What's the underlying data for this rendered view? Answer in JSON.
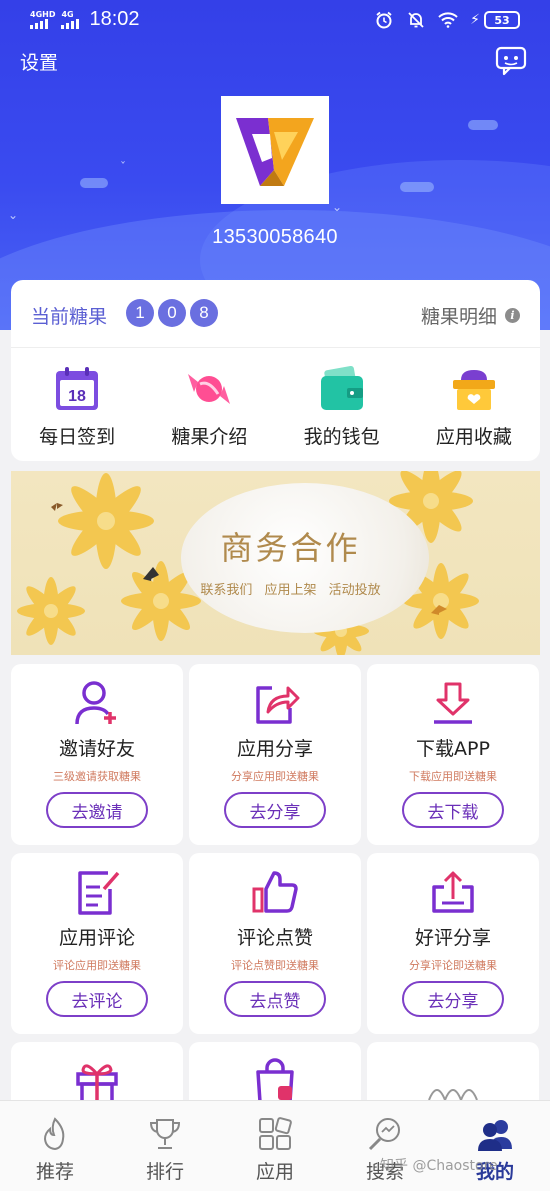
{
  "status_bar": {
    "network1": "4GHD",
    "network2": "4G",
    "time": "18:02",
    "battery": "53"
  },
  "header": {
    "settings_label": "设置",
    "phone": "13530058640"
  },
  "candy": {
    "label": "当前糖果",
    "digits": [
      "1",
      "0",
      "8"
    ],
    "detail_label": "糖果明细"
  },
  "quick_actions": [
    {
      "label": "每日签到",
      "icon": "calendar-icon",
      "day": "18"
    },
    {
      "label": "糖果介绍",
      "icon": "candy-icon"
    },
    {
      "label": "我的钱包",
      "icon": "wallet-icon"
    },
    {
      "label": "应用收藏",
      "icon": "favorites-box-icon"
    }
  ],
  "banner": {
    "title": "商务合作",
    "subtitle": "联系我们 应用上架 活动投放"
  },
  "tasks": [
    {
      "name": "邀请好友",
      "desc": "三级邀请获取糖果",
      "button": "去邀请",
      "icon": "add-user-icon"
    },
    {
      "name": "应用分享",
      "desc": "分享应用即送糖果",
      "button": "去分享",
      "icon": "share-icon"
    },
    {
      "name": "下载APP",
      "desc": "下载应用即送糖果",
      "button": "去下载",
      "icon": "download-icon"
    },
    {
      "name": "应用评论",
      "desc": "评论应用即送糖果",
      "button": "去评论",
      "icon": "edit-note-icon"
    },
    {
      "name": "评论点赞",
      "desc": "评论点赞即送糖果",
      "button": "去点赞",
      "icon": "thumbs-up-icon"
    },
    {
      "name": "好评分享",
      "desc": "分享评论即送糖果",
      "button": "去分享",
      "icon": "upload-share-icon"
    }
  ],
  "bottom_nav": [
    {
      "label": "推荐",
      "icon": "flame-icon"
    },
    {
      "label": "排行",
      "icon": "trophy-icon"
    },
    {
      "label": "应用",
      "icon": "apps-grid-icon"
    },
    {
      "label": "搜索",
      "icon": "search-icon"
    },
    {
      "label": "我的",
      "icon": "user-group-icon",
      "active": true
    }
  ],
  "watermark": "知乎 @Chaostore",
  "colors": {
    "header_blue": "#3a4bf0",
    "accent_purple": "#7d3fc8",
    "candy_label": "#5b5fd3",
    "task_desc": "#d07a5f"
  }
}
